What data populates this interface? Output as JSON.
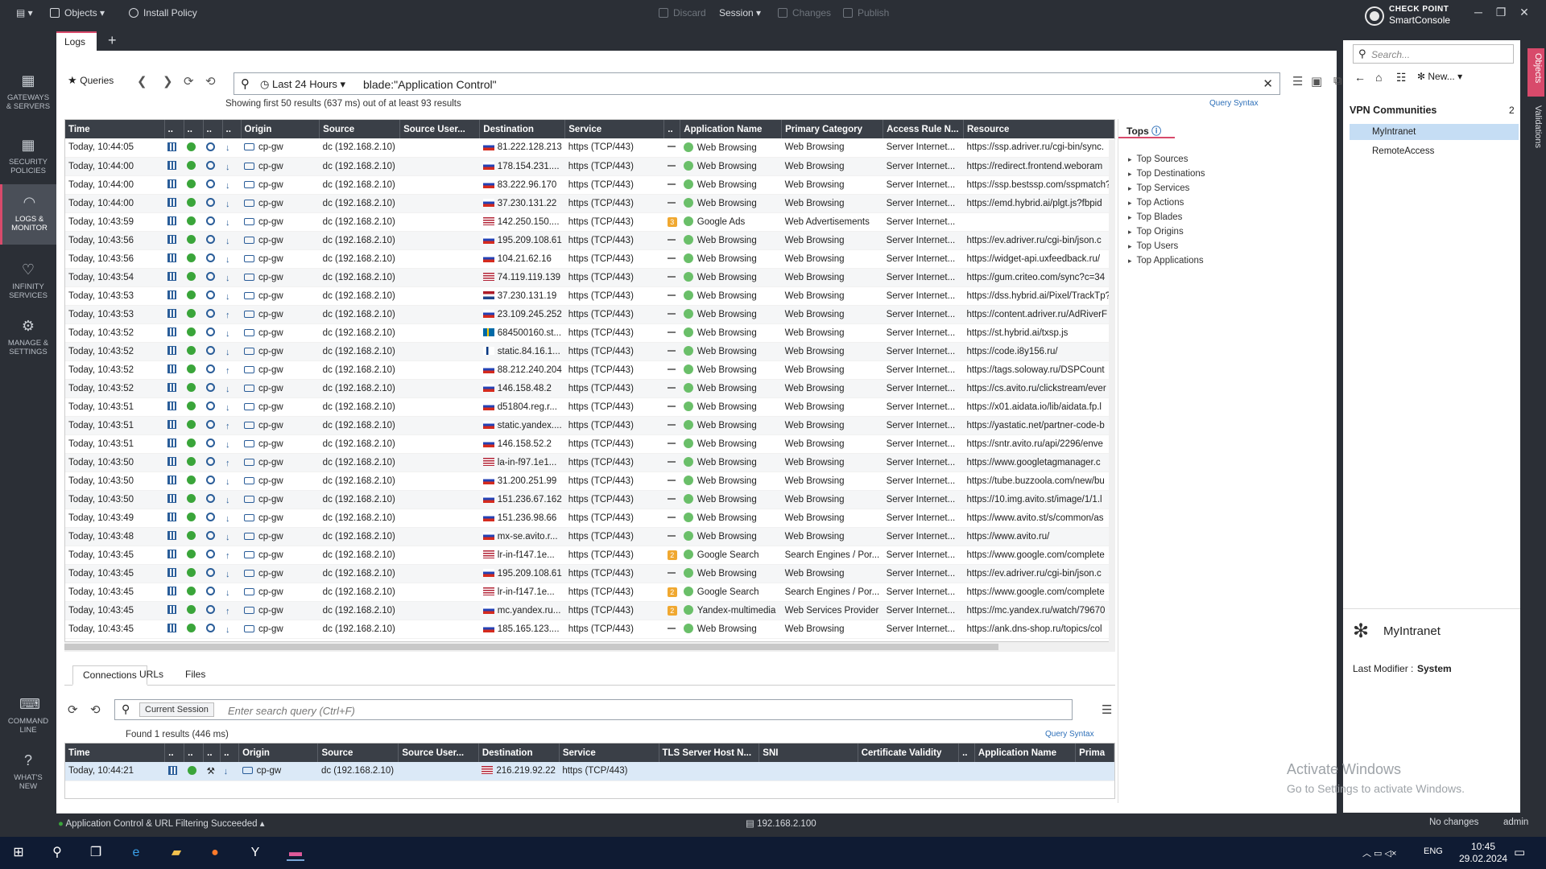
{
  "titlebar": {
    "objects": "Objects",
    "install_policy": "Install Policy",
    "discard": "Discard",
    "session": "Session",
    "changes": "Changes",
    "publish": "Publish",
    "brand_line1": "CHECK POINT",
    "brand_line2": "SmartConsole"
  },
  "nav": [
    {
      "label1": "GATEWAYS",
      "label2": "& SERVERS"
    },
    {
      "label1": "SECURITY",
      "label2": "POLICIES"
    },
    {
      "label1": "LOGS &",
      "label2": "MONITOR"
    },
    {
      "label1": "INFINITY",
      "label2": "SERVICES"
    },
    {
      "label1": "MANAGE &",
      "label2": "SETTINGS"
    },
    {
      "label1": "COMMAND",
      "label2": "LINE"
    },
    {
      "label1": "WHAT'S",
      "label2": "NEW"
    }
  ],
  "tabs": {
    "logs": "Logs"
  },
  "query": {
    "queries_label": "Queries",
    "time_range": "Last 24 Hours",
    "text": "blade:\"Application Control\"",
    "results_info": "Showing first 50 results (637 ms) out of at least 93 results",
    "syntax": "Query Syntax"
  },
  "table": {
    "columns": [
      "Time",
      "..",
      "..",
      "..",
      "..",
      "Origin",
      "Source",
      "Source User...",
      "Destination",
      "Service",
      "..",
      "Application Name",
      "Primary Category",
      "Access Rule N...",
      "Resource"
    ],
    "rows": [
      [
        "Today, 10:44:05",
        "dn",
        "cp-gw",
        "dc (192.168.2.10)",
        "ru",
        "81.222.128.213",
        "https (TCP/443)",
        "-",
        "Web Browsing",
        "Web Browsing",
        "Server Internet...",
        "https://ssp.adriver.ru/cgi-bin/sync."
      ],
      [
        "Today, 10:44:00",
        "dn",
        "cp-gw",
        "dc (192.168.2.10)",
        "ru",
        "178.154.231....",
        "https (TCP/443)",
        "-",
        "Web Browsing",
        "Web Browsing",
        "Server Internet...",
        "https://redirect.frontend.weboram"
      ],
      [
        "Today, 10:44:00",
        "dn",
        "cp-gw",
        "dc (192.168.2.10)",
        "ru",
        "83.222.96.170",
        "https (TCP/443)",
        "-",
        "Web Browsing",
        "Web Browsing",
        "Server Internet...",
        "https://ssp.bestssp.com/sspmatch?"
      ],
      [
        "Today, 10:44:00",
        "dn",
        "cp-gw",
        "dc (192.168.2.10)",
        "ru",
        "37.230.131.22",
        "https (TCP/443)",
        "-",
        "Web Browsing",
        "Web Browsing",
        "Server Internet...",
        "https://emd.hybrid.ai/plgt.js?fbpid"
      ],
      [
        "Today, 10:43:59",
        "dn",
        "cp-gw",
        "dc (192.168.2.10)",
        "us",
        "142.250.150....",
        "https (TCP/443)",
        "3",
        "Google Ads",
        "Web Advertisements",
        "Server Internet...",
        ""
      ],
      [
        "Today, 10:43:56",
        "dn",
        "cp-gw",
        "dc (192.168.2.10)",
        "ru",
        "195.209.108.61",
        "https (TCP/443)",
        "-",
        "Web Browsing",
        "Web Browsing",
        "Server Internet...",
        "https://ev.adriver.ru/cgi-bin/json.c"
      ],
      [
        "Today, 10:43:56",
        "dn",
        "cp-gw",
        "dc (192.168.2.10)",
        "ru",
        "104.21.62.16",
        "https (TCP/443)",
        "-",
        "Web Browsing",
        "Web Browsing",
        "Server Internet...",
        "https://widget-api.uxfeedback.ru/"
      ],
      [
        "Today, 10:43:54",
        "dn",
        "cp-gw",
        "dc (192.168.2.10)",
        "us",
        "74.119.119.139",
        "https (TCP/443)",
        "-",
        "Web Browsing",
        "Web Browsing",
        "Server Internet...",
        "https://gum.criteo.com/sync?c=34"
      ],
      [
        "Today, 10:43:53",
        "dn",
        "cp-gw",
        "dc (192.168.2.10)",
        "nl",
        "37.230.131.19",
        "https (TCP/443)",
        "-",
        "Web Browsing",
        "Web Browsing",
        "Server Internet...",
        "https://dss.hybrid.ai/Pixel/TrackTp?"
      ],
      [
        "Today, 10:43:53",
        "up",
        "cp-gw",
        "dc (192.168.2.10)",
        "ru",
        "23.109.245.252",
        "https (TCP/443)",
        "-",
        "Web Browsing",
        "Web Browsing",
        "Server Internet...",
        "https://content.adriver.ru/AdRiverF"
      ],
      [
        "Today, 10:43:52",
        "dn",
        "cp-gw",
        "dc (192.168.2.10)",
        "se",
        "684500160.st...",
        "https (TCP/443)",
        "-",
        "Web Browsing",
        "Web Browsing",
        "Server Internet...",
        "https://st.hybrid.ai/txsp.js"
      ],
      [
        "Today, 10:43:52",
        "dn",
        "cp-gw",
        "dc (192.168.2.10)",
        "fi",
        "static.84.16.1...",
        "https (TCP/443)",
        "-",
        "Web Browsing",
        "Web Browsing",
        "Server Internet...",
        "https://code.i8y156.ru/"
      ],
      [
        "Today, 10:43:52",
        "up",
        "cp-gw",
        "dc (192.168.2.10)",
        "ru",
        "88.212.240.204",
        "https (TCP/443)",
        "-",
        "Web Browsing",
        "Web Browsing",
        "Server Internet...",
        "https://tags.soloway.ru/DSPCount"
      ],
      [
        "Today, 10:43:52",
        "dn",
        "cp-gw",
        "dc (192.168.2.10)",
        "ru",
        "146.158.48.2",
        "https (TCP/443)",
        "-",
        "Web Browsing",
        "Web Browsing",
        "Server Internet...",
        "https://cs.avito.ru/clickstream/ever"
      ],
      [
        "Today, 10:43:51",
        "dn",
        "cp-gw",
        "dc (192.168.2.10)",
        "ru",
        "d51804.reg.r...",
        "https (TCP/443)",
        "-",
        "Web Browsing",
        "Web Browsing",
        "Server Internet...",
        "https://x01.aidata.io/lib/aidata.fp.l"
      ],
      [
        "Today, 10:43:51",
        "up",
        "cp-gw",
        "dc (192.168.2.10)",
        "ru",
        "static.yandex....",
        "https (TCP/443)",
        "-",
        "Web Browsing",
        "Web Browsing",
        "Server Internet...",
        "https://yastatic.net/partner-code-b"
      ],
      [
        "Today, 10:43:51",
        "dn",
        "cp-gw",
        "dc (192.168.2.10)",
        "ru",
        "146.158.52.2",
        "https (TCP/443)",
        "-",
        "Web Browsing",
        "Web Browsing",
        "Server Internet...",
        "https://sntr.avito.ru/api/2296/enve"
      ],
      [
        "Today, 10:43:50",
        "up",
        "cp-gw",
        "dc (192.168.2.10)",
        "us",
        "la-in-f97.1e1...",
        "https (TCP/443)",
        "-",
        "Web Browsing",
        "Web Browsing",
        "Server Internet...",
        "https://www.googletagmanager.c"
      ],
      [
        "Today, 10:43:50",
        "dn",
        "cp-gw",
        "dc (192.168.2.10)",
        "ru",
        "31.200.251.99",
        "https (TCP/443)",
        "-",
        "Web Browsing",
        "Web Browsing",
        "Server Internet...",
        "https://tube.buzzoola.com/new/bu"
      ],
      [
        "Today, 10:43:50",
        "dn",
        "cp-gw",
        "dc (192.168.2.10)",
        "ru",
        "151.236.67.162",
        "https (TCP/443)",
        "-",
        "Web Browsing",
        "Web Browsing",
        "Server Internet...",
        "https://10.img.avito.st/image/1/1.l"
      ],
      [
        "Today, 10:43:49",
        "dn",
        "cp-gw",
        "dc (192.168.2.10)",
        "ru",
        "151.236.98.66",
        "https (TCP/443)",
        "-",
        "Web Browsing",
        "Web Browsing",
        "Server Internet...",
        "https://www.avito.st/s/common/as"
      ],
      [
        "Today, 10:43:48",
        "dn",
        "cp-gw",
        "dc (192.168.2.10)",
        "ru",
        "mx-se.avito.r...",
        "https (TCP/443)",
        "-",
        "Web Browsing",
        "Web Browsing",
        "Server Internet...",
        "https://www.avito.ru/"
      ],
      [
        "Today, 10:43:45",
        "up",
        "cp-gw",
        "dc (192.168.2.10)",
        "us",
        "lr-in-f147.1e...",
        "https (TCP/443)",
        "2",
        "Google Search",
        "Search Engines / Por...",
        "Server Internet...",
        "https://www.google.com/complete"
      ],
      [
        "Today, 10:43:45",
        "dn",
        "cp-gw",
        "dc (192.168.2.10)",
        "ru",
        "195.209.108.61",
        "https (TCP/443)",
        "-",
        "Web Browsing",
        "Web Browsing",
        "Server Internet...",
        "https://ev.adriver.ru/cgi-bin/json.c"
      ],
      [
        "Today, 10:43:45",
        "dn",
        "cp-gw",
        "dc (192.168.2.10)",
        "us",
        "lr-in-f147.1e...",
        "https (TCP/443)",
        "2",
        "Google Search",
        "Search Engines / Por...",
        "Server Internet...",
        "https://www.google.com/complete"
      ],
      [
        "Today, 10:43:45",
        "up",
        "cp-gw",
        "dc (192.168.2.10)",
        "ru",
        "mc.yandex.ru...",
        "https (TCP/443)",
        "2",
        "Yandex-multimedia",
        "Web Services Provider",
        "Server Internet...",
        "https://mc.yandex.ru/watch/79670"
      ],
      [
        "Today, 10:43:45",
        "dn",
        "cp-gw",
        "dc (192.168.2.10)",
        "ru",
        "185.165.123....",
        "https (TCP/443)",
        "-",
        "Web Browsing",
        "Web Browsing",
        "Server Internet...",
        "https://ank.dns-shop.ru/topics/col"
      ]
    ]
  },
  "tops": {
    "title": "Tops",
    "items": [
      "Top Sources",
      "Top Destinations",
      "Top Services",
      "Top Actions",
      "Top Blades",
      "Top Origins",
      "Top Users",
      "Top Applications"
    ]
  },
  "bottom": {
    "tabs": [
      "Connections",
      "URLs",
      "Files"
    ],
    "session": "Current Session",
    "placeholder": "Enter search query (Ctrl+F)",
    "found": "Found 1 results (446 ms)",
    "syntax": "Query Syntax",
    "columns": [
      "Time",
      "..",
      "..",
      "..",
      "..",
      "Origin",
      "Source",
      "Source User...",
      "Destination",
      "Service",
      "TLS Server Host N...",
      "SNI",
      "Certificate Validity",
      "..",
      "Application Name",
      "Prima"
    ],
    "row": [
      "Today, 10:44:21",
      "cp-gw",
      "dc (192.168.2.10)",
      "216.219.92.22",
      "https (TCP/443)"
    ]
  },
  "status": {
    "left": "Application Control & URL Filtering Succeeded",
    "server": "192.168.2.100",
    "changes": "No changes",
    "user": "admin"
  },
  "right": {
    "search": "Search...",
    "new": "New...",
    "vpn_title": "VPN Communities",
    "vpn_count": "2",
    "items": [
      "MyIntranet",
      "RemoteAccess"
    ],
    "detail_title": "MyIntranet",
    "modifier_label": "Last Modifier :",
    "modifier_value": "System"
  },
  "sidetabs": [
    "Objects",
    "Validations"
  ],
  "watermark": {
    "l1": "Activate Windows",
    "l2": "Go to Settings to activate Windows."
  },
  "taskbar": {
    "lang": "ENG",
    "time": "10:45",
    "date": "29.02.2024"
  }
}
